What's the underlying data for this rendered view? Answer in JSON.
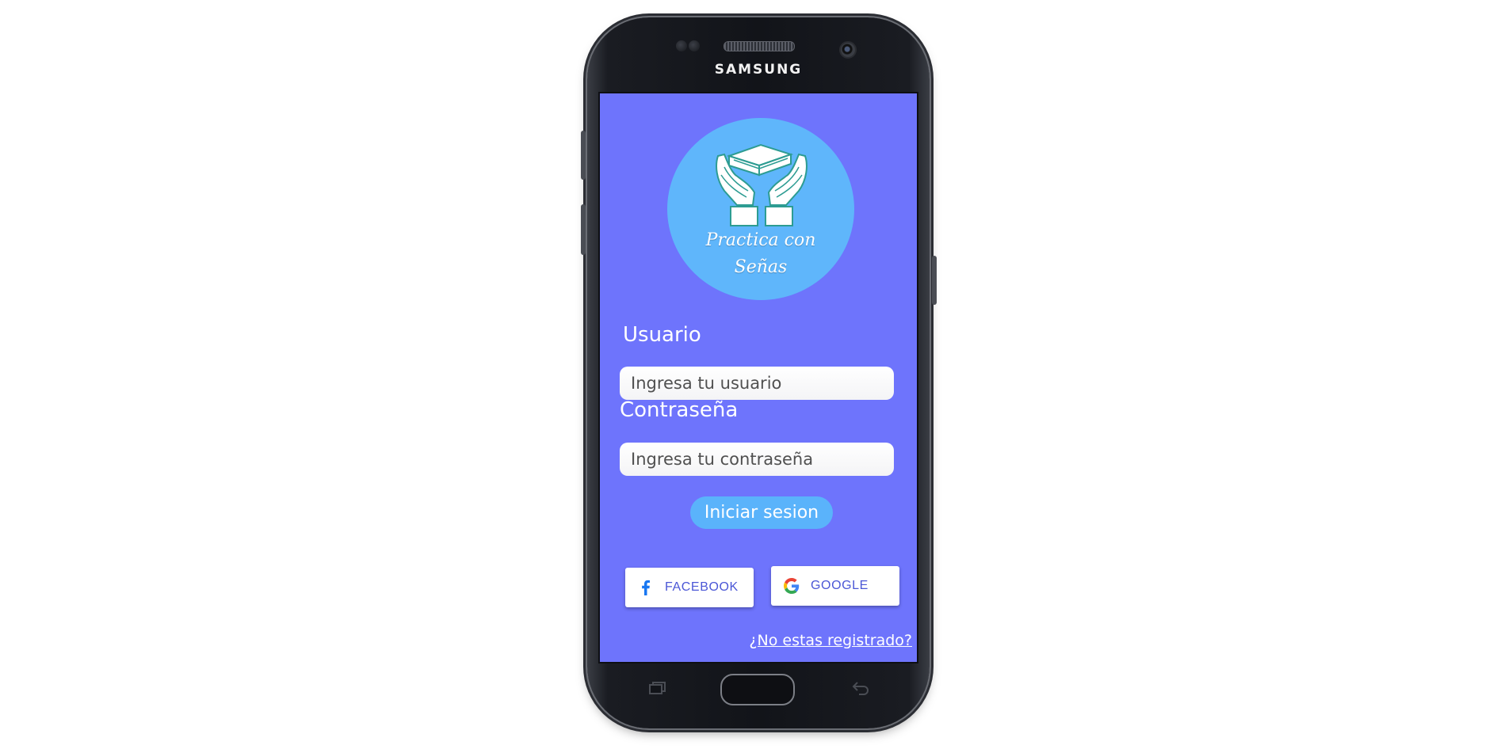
{
  "device": {
    "brand": "SAMSUNG"
  },
  "logo": {
    "line1": "Practica con",
    "line2": "Señas"
  },
  "form": {
    "user_label": "Usuario",
    "user_placeholder": "Ingresa tu usuario",
    "password_label": "Contraseña",
    "password_placeholder": "Ingresa tu contraseña",
    "login_button": "Iniciar sesion"
  },
  "social": {
    "facebook_label": "FACEBOOK",
    "google_label": "GOOGLE"
  },
  "register_link": "¿No estas registrado?",
  "colors": {
    "screen_background": "#6e74fc",
    "logo_circle": "#5fb6fb",
    "login_button": "#5ab3fb",
    "social_text": "#4b57d6",
    "facebook_blue": "#1877f2"
  },
  "icons": {
    "logo": "hands-holding-books-icon",
    "facebook": "facebook-icon",
    "google": "google-icon",
    "recent_apps": "recent-apps-icon",
    "back": "back-icon"
  }
}
